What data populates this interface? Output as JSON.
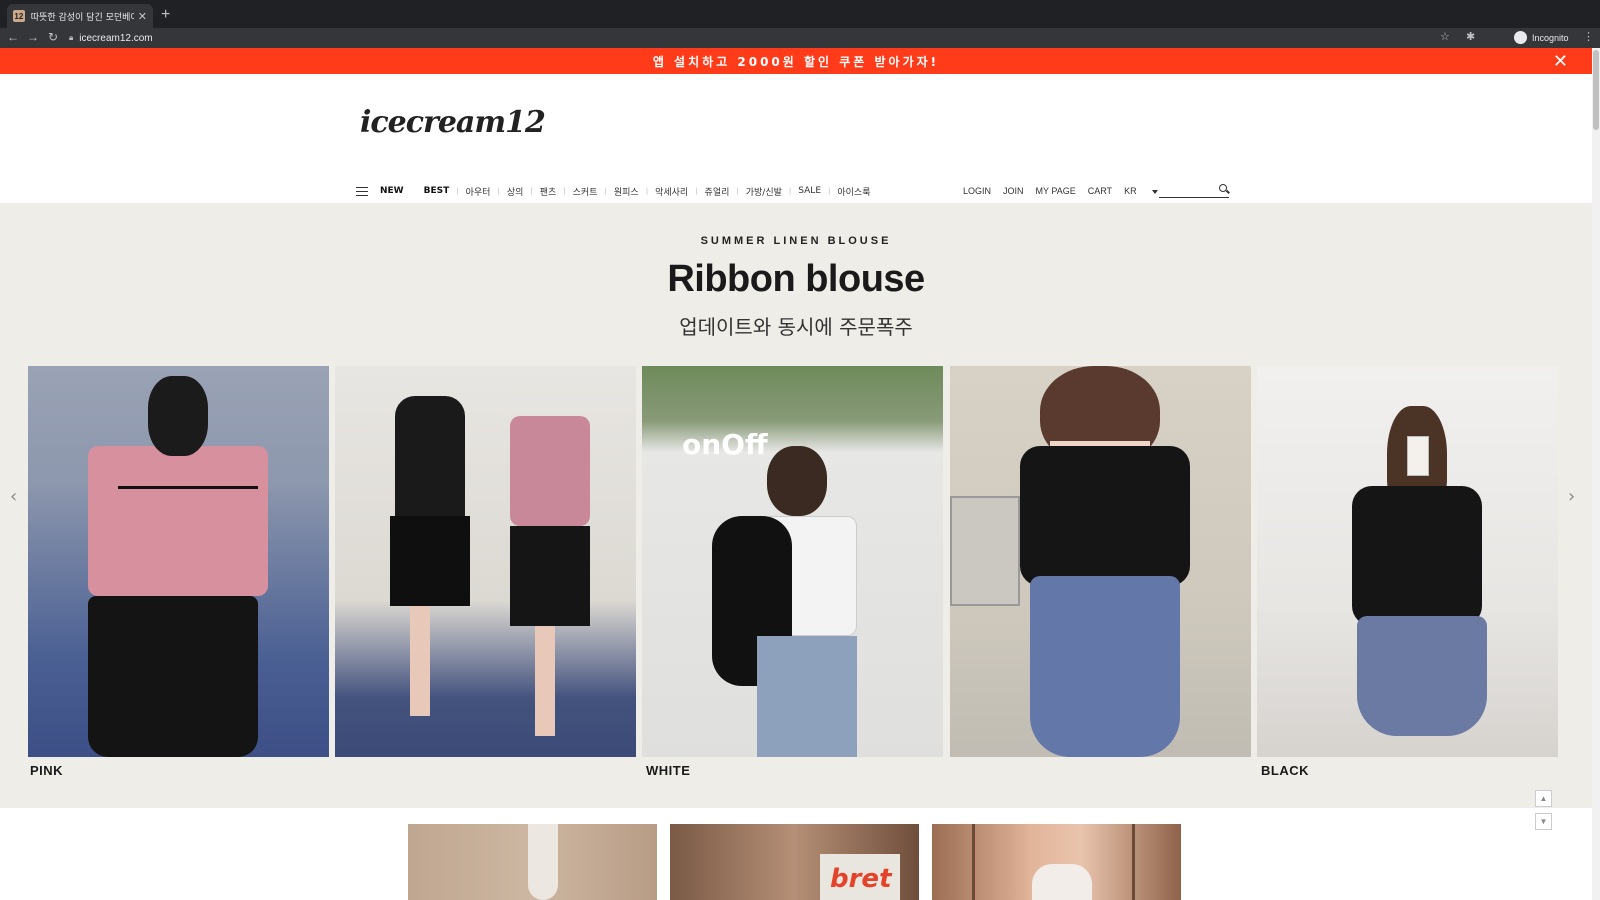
{
  "browser": {
    "tab_title": "따뜻한 감성이 담긴 모던베이직, 아이",
    "tab_favicon": "12",
    "url": "icecream12.com",
    "profile_label": "Incognito"
  },
  "promo": {
    "text": "앱 설치하고 2000원 할인 쿠폰 받아가자!",
    "close_label": "✕"
  },
  "logo": "icecream12",
  "main_nav": [
    {
      "label": "NEW",
      "bold": true
    },
    {
      "label": "BEST",
      "bold": true
    },
    {
      "label": "아우터"
    },
    {
      "label": "상의"
    },
    {
      "label": "팬츠"
    },
    {
      "label": "스커트"
    },
    {
      "label": "원피스"
    },
    {
      "label": "악세사리"
    },
    {
      "label": "쥬얼리"
    },
    {
      "label": "가방/신발"
    },
    {
      "label": "SALE"
    },
    {
      "label": "아이스룩"
    }
  ],
  "user_nav": {
    "login": "LOGIN",
    "join": "JOIN",
    "mypage": "MY PAGE",
    "cart": "CART",
    "lang": "KR"
  },
  "hero": {
    "kicker": "SUMMER LINEN BLOUSE",
    "title": "Ribbon blouse",
    "subtitle": "업데이트와 동시에 주문폭주",
    "prev_arrow": "‹",
    "next_arrow": "›",
    "slides": [
      {
        "label": "PINK",
        "color": "#c88a9a"
      },
      {
        "label": "",
        "color": "#6d6a6e"
      },
      {
        "label": "WHITE",
        "color": "#d9dcde"
      },
      {
        "label": "",
        "color": "#7c8aa8"
      },
      {
        "label": "BLACK",
        "color": "#b3aca8"
      }
    ]
  },
  "side_buttons": {
    "up": "▲",
    "down": "▼"
  },
  "colors": {
    "promo_bg": "#ff3b1a",
    "hero_bg": "#efede8"
  }
}
